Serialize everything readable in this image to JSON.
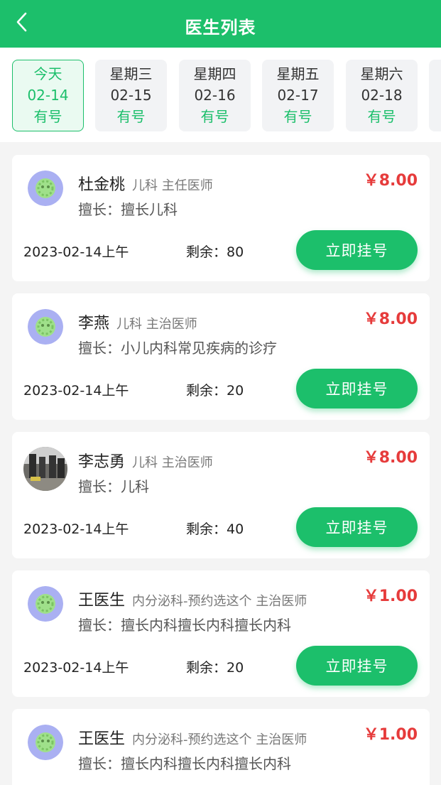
{
  "header": {
    "title": "医生列表",
    "back_icon": "chevron-left-icon"
  },
  "dates": [
    {
      "weekday": "今天",
      "date": "02-14",
      "status": "有号",
      "selected": true
    },
    {
      "weekday": "星期三",
      "date": "02-15",
      "status": "有号"
    },
    {
      "weekday": "星期四",
      "date": "02-16",
      "status": "有号"
    },
    {
      "weekday": "星期五",
      "date": "02-17",
      "status": "有号"
    },
    {
      "weekday": "星期六",
      "date": "02-18",
      "status": "有号"
    }
  ],
  "doctors": [
    {
      "name": "杜金桃",
      "title": "儿科 主任医师",
      "skill": "擅长：擅长儿科",
      "price": "￥8.00",
      "date": "2023-02-14上午",
      "remain": "剩余：80",
      "button": "立即挂号",
      "avatar": "default-avatar"
    },
    {
      "name": "李燕",
      "title": "儿科 主治医师",
      "skill": "擅长：小儿内科常见疾病的诊疗",
      "price": "￥8.00",
      "date": "2023-02-14上午",
      "remain": "剩余：20",
      "button": "立即挂号",
      "avatar": "default-avatar"
    },
    {
      "name": "李志勇",
      "title": "儿科 主治医师",
      "skill": "擅长：儿科",
      "price": "￥8.00",
      "date": "2023-02-14上午",
      "remain": "剩余：40",
      "button": "立即挂号",
      "avatar": "photo-avatar"
    },
    {
      "name": "王医生",
      "title": "内分泌科-预约选这个 主治医师",
      "skill": "擅长：擅长内科擅长内科擅长内科",
      "price": "￥1.00",
      "date": "2023-02-14上午",
      "remain": "剩余：20",
      "button": "立即挂号",
      "avatar": "default-avatar"
    },
    {
      "name": "王医生",
      "title": "内分泌科-预约选这个 主治医师",
      "skill": "擅长：擅长内科擅长内科擅长内科",
      "price": "￥1.00",
      "avatar": "default-avatar"
    }
  ]
}
